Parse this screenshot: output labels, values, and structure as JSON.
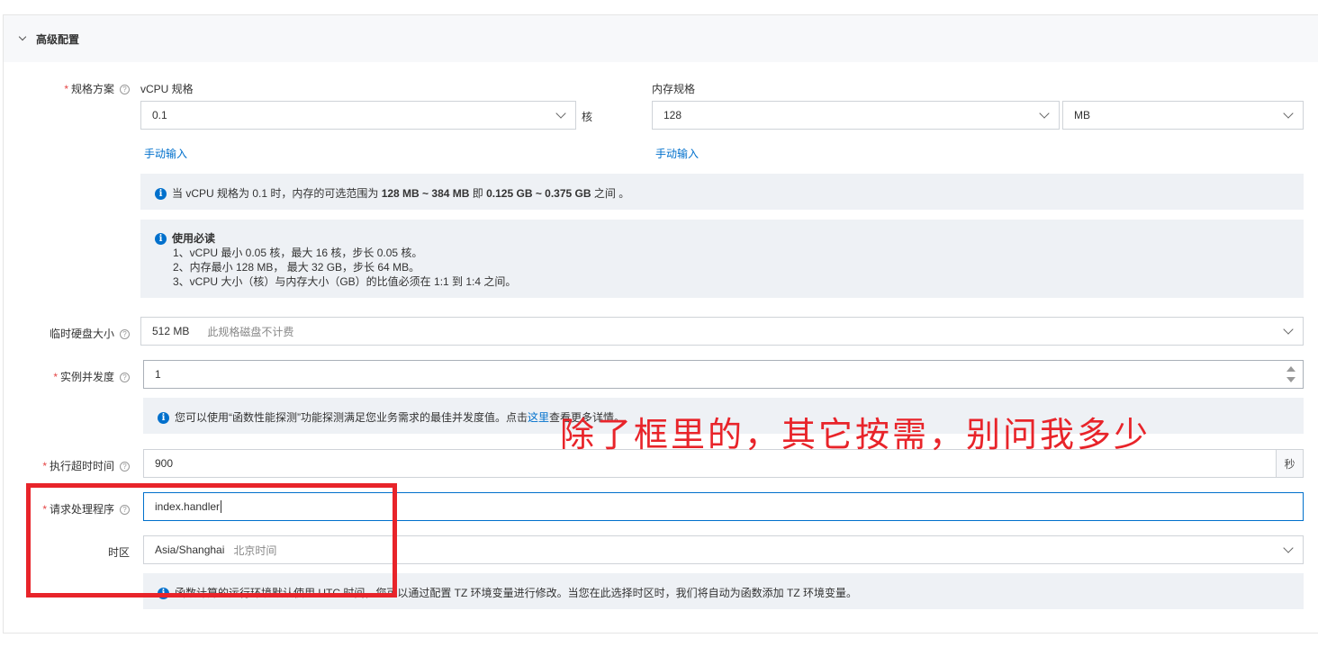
{
  "section": {
    "title": "高级配置"
  },
  "spec": {
    "label": "规格方案",
    "vcpu": {
      "label": "vCPU 规格",
      "value": "0.1",
      "unit": "核",
      "manual_link": "手动输入"
    },
    "memory": {
      "label": "内存规格",
      "value": "128",
      "unit_value": "MB",
      "manual_link": "手动输入"
    },
    "range_notice": {
      "prefix": "当 vCPU 规格为 0.1 时，内存的可选范围为",
      "range_mb": "128 MB ~ 384 MB",
      "mid": "即",
      "range_gb": "0.125 GB ~ 0.375 GB",
      "suffix": "之间 。"
    },
    "must_read": {
      "title": "使用必读",
      "lines": [
        "1、vCPU 最小 0.05 核，最大 16 核，步长 0.05 核。",
        "2、内存最小 128 MB， 最大 32 GB，步长 64 MB。",
        "3、vCPU 大小（核）与内存大小（GB）的比值必须在 1:1 到 1:4 之间。"
      ]
    }
  },
  "disk": {
    "label": "临时硬盘大小",
    "value": "512 MB",
    "note": "此规格磁盘不计费"
  },
  "concurrency": {
    "label": "实例并发度",
    "value": "1",
    "notice_prefix": "您可以使用“函数性能探测”功能探测满足您业务需求的最佳并发度值。点击",
    "notice_link": "这里",
    "notice_suffix": "查看更多详情。"
  },
  "timeout": {
    "label": "执行超时时间",
    "value": "900",
    "unit": "秒"
  },
  "handler": {
    "label": "请求处理程序",
    "value": "index.handler"
  },
  "timezone": {
    "label": "时区",
    "value": "Asia/Shanghai",
    "note": "北京时间",
    "notice": "函数计算的运行环境默认使用 UTC 时间，您可以通过配置 TZ 环境变量进行修改。当您在此选择时区时，我们将自动为函数添加 TZ 环境变量。"
  },
  "annotation": {
    "text": "除了框里的，其它按需，别问我多少"
  },
  "colors": {
    "accent": "#0070cc",
    "required": "#e54545",
    "annotation": "#e8242a"
  }
}
